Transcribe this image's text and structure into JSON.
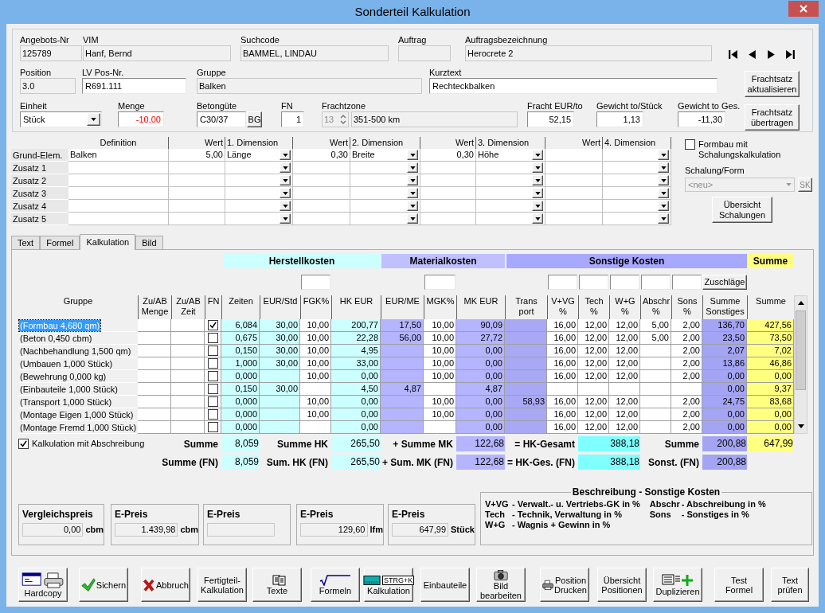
{
  "window": {
    "title": "Sonderteil Kalkulation"
  },
  "header": {
    "rows": [
      {
        "fields": [
          {
            "label": "Angebots-Nr",
            "value": "125789",
            "kind": "readonly",
            "alert": false
          },
          {
            "label": "VIM",
            "value": "Hanf, Bernd",
            "kind": "readonly",
            "alert": false
          },
          {
            "label": "Suchcode",
            "value": "BAMMEL, LINDAU",
            "kind": "readonly",
            "alert": false
          },
          {
            "label": "Auftrag",
            "kind": "readonly"
          },
          {
            "label": "Auftragsbezeichnung",
            "value": "Herocrete 2",
            "kind": "readonly",
            "alert": false
          }
        ]
      },
      {
        "fields": [
          {
            "label": "Position",
            "value": "3.0",
            "kind": "readonly",
            "alert": false
          },
          {
            "label": "LV Pos-Nr.",
            "value": "R691.111",
            "kind": "input",
            "alert": false
          },
          {
            "label": "Gruppe",
            "value": "Balken",
            "kind": "readonly",
            "alert": false
          },
          {
            "label": "Kurztext",
            "value": "Rechteckbalken",
            "kind": "input",
            "alert": false
          }
        ],
        "button": "Frachtsatz\naktualisieren"
      },
      {
        "fields": [
          {
            "label": "Einheit",
            "value": "Stück",
            "kind": "select",
            "alert": false
          },
          {
            "label": "Menge",
            "value": "-10,00",
            "kind": "input",
            "alert": true
          },
          {
            "label": "Betongüte",
            "value": "C30/37",
            "kind": "input",
            "button": "BG",
            "alert": false
          },
          {
            "label": "FN",
            "value": "1",
            "kind": "input",
            "alert": false
          },
          {
            "label": "Frachtzone",
            "spin": "13",
            "value": "351-500 km",
            "kind": "spin",
            "alert": false
          },
          {
            "label": "Fracht EUR/to",
            "value": "52,15",
            "kind": "input",
            "alert": false
          },
          {
            "label": "Gewicht to/Stück",
            "value": "1,13",
            "kind": "input",
            "alert": false
          },
          {
            "label": "Gewicht to Ges.",
            "value": "-11,30",
            "kind": "input",
            "alert": false
          }
        ],
        "button": "Frachtsatz\nübertragen"
      }
    ]
  },
  "definition": {
    "columns": [
      "Definition",
      "Wert",
      "1. Dimension",
      "Wert",
      "2. Dimension",
      "Wert",
      "3. Dimension",
      "Wert",
      "4. Dimension"
    ],
    "rows": [
      {
        "label": "Grund-Elem.",
        "cells": [
          "Balken",
          "5,00",
          "Länge",
          "0,30",
          "Breite",
          "0,30",
          "Höhe",
          "",
          ""
        ]
      },
      {
        "label": "Zusatz 1"
      },
      {
        "label": "Zusatz 2"
      },
      {
        "label": "Zusatz 3"
      },
      {
        "label": "Zusatz 4"
      },
      {
        "label": "Zusatz 5"
      }
    ]
  },
  "schalung": {
    "option": {
      "label": "Formbau mit\nSchalungskalkulation",
      "checked": false
    },
    "label": "Schalung/Form",
    "select": {
      "value": "<neu>",
      "disabled": true
    },
    "sk_button": {
      "label": "SK",
      "disabled": true
    },
    "button": "Übersicht\nSchalungen"
  },
  "tabs": [
    {
      "label": "Text",
      "selected": false
    },
    {
      "label": "Formel",
      "selected": false
    },
    {
      "label": "Kalkulation",
      "selected": true
    },
    {
      "label": "Bild",
      "selected": false
    }
  ],
  "kalkulation": {
    "groups": [
      {
        "label": "Herstellkosten",
        "color": "#ccffff"
      },
      {
        "label": "Materialkosten",
        "color": "#c0c0ff"
      },
      {
        "label": "Sonstige Kosten",
        "color": "#a8a8ff"
      },
      {
        "label": "Summe",
        "color": "#ffff80"
      }
    ],
    "zuschlaege_button": "Zuschläge",
    "columns": [
      "Gruppe",
      "Zu/AB\nMenge",
      "Zu/AB\nZeit",
      "FN",
      "Zeiten",
      "EUR/Std",
      "FGK%",
      "HK EUR",
      "EUR/ME",
      "MGK%",
      "MK EUR",
      "Trans\nport",
      "V+VG\n%",
      "Tech\n%",
      "W+G\n%",
      "Abschr\n%",
      "Sons\n%",
      "Summe\nSonstiges",
      "Summe"
    ],
    "rows": [
      {
        "selected": true,
        "cells": [
          "(Formbau 4,680 qm)",
          "",
          "",
          {
            "checked": true
          },
          "6,084",
          "30,00",
          "10,00",
          "200,77",
          "17,50",
          "10,00",
          "90,09",
          "",
          "16,00",
          "12,00",
          "12,00",
          "5,00",
          "2,00",
          "136,70",
          "427,56"
        ]
      },
      {
        "selected": false,
        "cells": [
          "(Beton 0,450 cbm)",
          "",
          "",
          {
            "checked": false
          },
          "0,675",
          "30,00",
          "10,00",
          "22,28",
          "56,00",
          "10,00",
          "27,72",
          "",
          "16,00",
          "12,00",
          "12,00",
          "5,00",
          "2,00",
          "23,50",
          "73,50"
        ]
      },
      {
        "selected": false,
        "cells": [
          "(Nachbehandlung 1,500 qm)",
          "",
          "",
          {
            "checked": false
          },
          "0,150",
          "30,00",
          "10,00",
          "4,95",
          "",
          "10,00",
          "0,00",
          "",
          "16,00",
          "12,00",
          "12,00",
          "",
          "2,00",
          "2,07",
          "7,02"
        ]
      },
      {
        "selected": false,
        "cells": [
          "(Umbauen 1,000 Stück)",
          "",
          "",
          {
            "checked": false
          },
          "1,000",
          "30,00",
          "10,00",
          "33,00",
          "",
          "10,00",
          "0,00",
          "",
          "16,00",
          "12,00",
          "12,00",
          "",
          "2,00",
          "13,86",
          "46,86"
        ]
      },
      {
        "selected": false,
        "cells": [
          "(Bewehrung 0,000 kg)",
          "",
          "",
          {
            "checked": false
          },
          "0,000",
          "",
          "10,00",
          "0,00",
          "",
          "10,00",
          "0,00",
          "",
          "16,00",
          "12,00",
          "12,00",
          "",
          "2,00",
          "0,00",
          "0,00"
        ]
      },
      {
        "selected": false,
        "cells": [
          "(Einbauteile 1,000 Stück)",
          "",
          "",
          {
            "checked": false
          },
          "0,150",
          "30,00",
          "",
          "4,50",
          "4,87",
          "",
          "4,87",
          "",
          "",
          "",
          "",
          "",
          "",
          "0,00",
          "9,37"
        ]
      },
      {
        "selected": false,
        "cells": [
          "(Transport 1,000 Stück)",
          "",
          "",
          {
            "checked": false
          },
          "0,000",
          "",
          "10,00",
          "0,00",
          "",
          "10,00",
          "0,00",
          "58,93",
          "16,00",
          "12,00",
          "12,00",
          "",
          "2,00",
          "24,75",
          "83,68"
        ]
      },
      {
        "selected": false,
        "cells": [
          "(Montage Eigen 1,000 Stück)",
          "",
          "",
          {
            "checked": false
          },
          "0,000",
          "",
          "10,00",
          "0,00",
          "",
          "10,00",
          "0,00",
          "",
          "16,00",
          "12,00",
          "12,00",
          "",
          "2,00",
          "0,00",
          "0,00"
        ]
      },
      {
        "selected": false,
        "cells": [
          "(Montage Fremd 1,000 Stück)",
          "",
          "",
          {
            "checked": false
          },
          "0,000",
          "",
          "",
          "0,00",
          "",
          "",
          "0,00",
          "",
          "16,00",
          "12,00",
          "12,00",
          "",
          "2,00",
          "0,00",
          "0,00"
        ]
      }
    ]
  },
  "summary": {
    "option": {
      "label": "Kalkulation mit Abschreibung",
      "checked": true
    },
    "rows": [
      {
        "items": [
          {
            "label": "Summe",
            "value": "8,059"
          },
          {
            "label": "Summe HK",
            "value": "265,50"
          },
          {
            "label": "+ Summe MK",
            "value": "122,68"
          },
          {
            "label": "= HK-Gesamt",
            "value": "388,18"
          },
          {
            "label": "Summe",
            "value": "200,88"
          }
        ],
        "total": "647,99"
      },
      {
        "items": [
          {
            "label": "Summe (FN)",
            "value": "8,059"
          },
          {
            "label": "Sum. HK (FN)",
            "value": "265,50"
          },
          {
            "label": "+ Sum. MK (FN)",
            "value": "122,68"
          },
          {
            "label": "= HK-Ges. (FN)",
            "value": "388,18"
          },
          {
            "label": "Sonst. (FN)",
            "value": "200,88"
          }
        ]
      }
    ]
  },
  "prices": [
    {
      "title": "Vergleichspreis",
      "value": "0,00",
      "unit": "cbm"
    },
    {
      "title": "E-Preis",
      "value": "1.439,98",
      "unit": "cbm"
    },
    {
      "title": "E-Preis"
    },
    {
      "title": "E-Preis",
      "value": "129,60",
      "unit": "lfm"
    },
    {
      "title": "E-Preis",
      "value": "647,99",
      "unit": "Stück"
    }
  ],
  "legend": {
    "title": "Beschreibung - Sonstige Kosten",
    "columns": [
      [
        {
          "abbr": "V+VG",
          "text": "- Verwalt.- u. Vertriebs-GK in %"
        },
        {
          "abbr": "Tech",
          "text": "- Technik, Verwaltung in %"
        },
        {
          "abbr": "W+G",
          "text": "- Wagnis + Gewinn in %"
        }
      ],
      [
        {
          "abbr": "Abschr",
          "text": "- Abschreibung in %"
        },
        {
          "abbr": "Sons",
          "text": "- Sonstiges in %"
        }
      ]
    ]
  },
  "buttons": [
    {
      "label": "Hardcopy",
      "kind": "printer"
    },
    {
      "label": "Sichern",
      "kind": "check"
    },
    {
      "label": "Abbruch",
      "kind": "cross"
    },
    {
      "label": "Fertigteil-\nKalkulation",
      "kind": "plain"
    },
    {
      "label": "Texte",
      "kind": "texts"
    },
    {
      "label": "Formeln",
      "kind": "formula"
    },
    {
      "label": "Kalkulation",
      "kind": "keyboard",
      "shortcut": "STRG+K"
    },
    {
      "label": "Einbauteile",
      "kind": "plain"
    },
    {
      "label": "Bild\nbearbeiten",
      "kind": "camera"
    },
    {
      "label": "Position\nDrucken",
      "kind": "printer2"
    },
    {
      "label": "Übersicht\nPositionen",
      "kind": "plain"
    },
    {
      "label": "Duplizieren",
      "kind": "duplicate"
    },
    {
      "label": "Test\nFormel",
      "kind": "plain"
    },
    {
      "label": "Text\nprüfen",
      "kind": "plain"
    }
  ]
}
